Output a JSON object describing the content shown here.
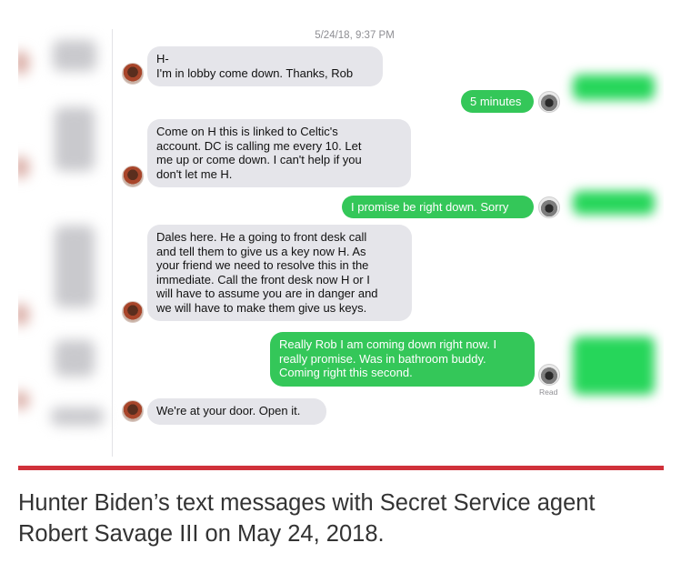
{
  "conversation": {
    "timestamp": "5/24/18, 9:37 PM",
    "messages": [
      {
        "sender": "rob",
        "text": "H-\nI'm in lobby come down. Thanks, Rob"
      },
      {
        "sender": "hunter",
        "text": "5 minutes"
      },
      {
        "sender": "rob",
        "text": "Come on H this is linked to Celtic's\naccount. DC is calling me every 10. Let\nme up or come down. I can't help if you\ndon't let me H."
      },
      {
        "sender": "hunter",
        "text": "I promise be right down. Sorry"
      },
      {
        "sender": "rob",
        "text": "Dales here. He a going to front desk call\nand tell them to give us a key now H. As\nyour friend we need to resolve this in the\nimmediate. Call the front desk now H or I\nwill have to assume you are in danger and\nwe will have to make them give us keys."
      },
      {
        "sender": "hunter",
        "text": "Really Rob I am coming down right now. I\nreally promise. Was in bathroom buddy.\nComing right this second."
      },
      {
        "sender": "rob",
        "text": "We're at your door. Open it."
      }
    ],
    "read_receipt": "Read"
  },
  "colors": {
    "incoming_bubble": "#e5e5ea",
    "outgoing_bubble": "#34c759",
    "rule": "#d0313a"
  },
  "caption": "Hunter Biden’s text messages with Secret Service agent Robert Savage III on May 24, 2018."
}
